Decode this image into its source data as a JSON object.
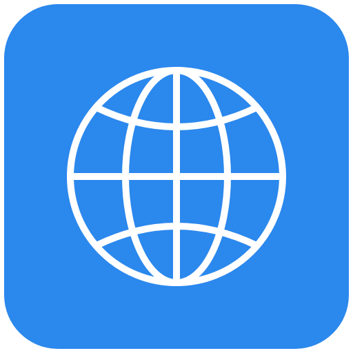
{
  "app_icon": {
    "icon_name": "globe-icon",
    "background_color": "#2B88ED",
    "glyph_color": "#FFFFFF"
  }
}
